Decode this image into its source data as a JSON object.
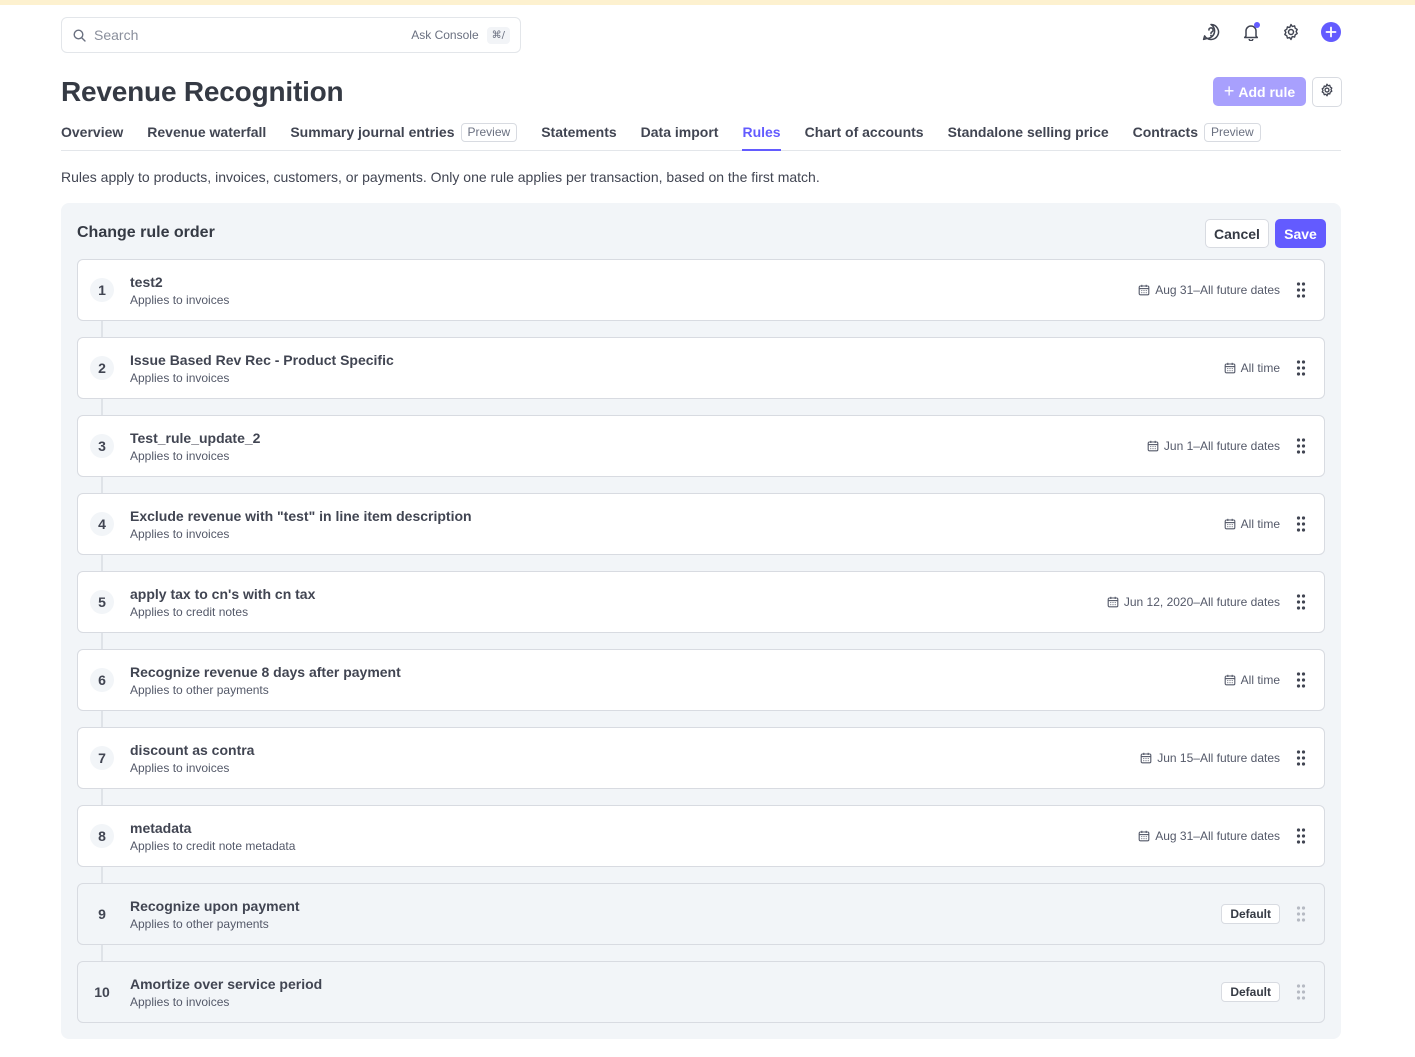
{
  "search": {
    "placeholder": "Search",
    "ask_label": "Ask Console",
    "shortcut": "⌘/"
  },
  "header_icons": [
    "help-icon",
    "bell-icon",
    "gear-icon",
    "plus-icon"
  ],
  "page": {
    "title": "Revenue Recognition",
    "add_rule_label": "Add rule",
    "description": "Rules apply to products, invoices, customers, or payments. Only one rule applies per transaction, based on the first match."
  },
  "tabs": [
    {
      "label": "Overview",
      "badge": ""
    },
    {
      "label": "Revenue waterfall",
      "badge": ""
    },
    {
      "label": "Summary journal entries",
      "badge": "Preview"
    },
    {
      "label": "Statements",
      "badge": ""
    },
    {
      "label": "Data import",
      "badge": ""
    },
    {
      "label": "Rules",
      "badge": "",
      "active": true
    },
    {
      "label": "Chart of accounts",
      "badge": ""
    },
    {
      "label": "Standalone selling price",
      "badge": ""
    },
    {
      "label": "Contracts",
      "badge": "Preview"
    }
  ],
  "panel": {
    "title": "Change rule order",
    "cancel_label": "Cancel",
    "save_label": "Save"
  },
  "rules": [
    {
      "num": "1",
      "name": "test2",
      "applies": "Applies to invoices",
      "dates": "Aug 31–All future dates",
      "default": false
    },
    {
      "num": "2",
      "name": "Issue Based Rev Rec - Product Specific",
      "applies": "Applies to invoices",
      "dates": "All time",
      "default": false
    },
    {
      "num": "3",
      "name": "Test_rule_update_2",
      "applies": "Applies to invoices",
      "dates": "Jun 1–All future dates",
      "default": false
    },
    {
      "num": "4",
      "name": "Exclude revenue with \"test\" in line item description",
      "applies": "Applies to invoices",
      "dates": "All time",
      "default": false
    },
    {
      "num": "5",
      "name": "apply tax to cn's with cn tax",
      "applies": "Applies to credit notes",
      "dates": "Jun 12, 2020–All future dates",
      "default": false
    },
    {
      "num": "6",
      "name": "Recognize revenue 8 days after payment",
      "applies": "Applies to other payments",
      "dates": "All time",
      "default": false
    },
    {
      "num": "7",
      "name": "discount as contra",
      "applies": "Applies to invoices",
      "dates": "Jun 15–All future dates",
      "default": false
    },
    {
      "num": "8",
      "name": "metadata",
      "applies": "Applies to credit note metadata",
      "dates": "Aug 31–All future dates",
      "default": false
    },
    {
      "num": "9",
      "name": "Recognize upon payment",
      "applies": "Applies to other payments",
      "dates": "Default",
      "default": true
    },
    {
      "num": "10",
      "name": "Amortize over service period",
      "applies": "Applies to invoices",
      "dates": "Default",
      "default": true
    }
  ],
  "colors": {
    "accent": "#635bff",
    "accent_light": "#a8a0fd",
    "panel_bg": "#f2f5f8",
    "top_strip": "#fdf1cf"
  }
}
